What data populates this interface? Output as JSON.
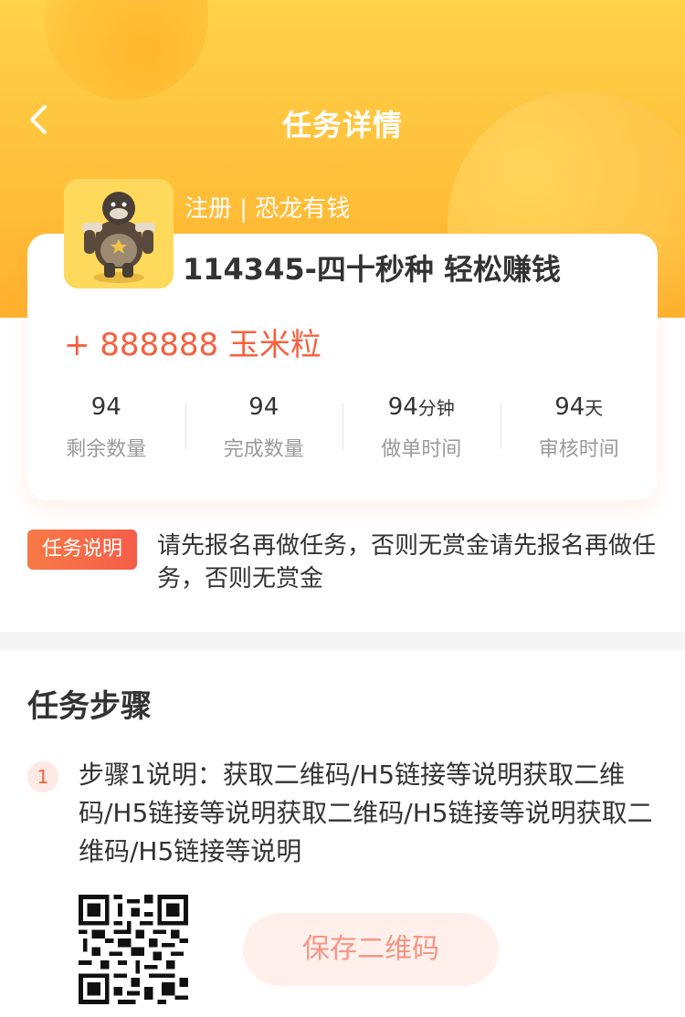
{
  "nav": {
    "title": "任务详情",
    "back_icon": "chevron-left-icon"
  },
  "task": {
    "tag": "注册 | 恐龙有钱",
    "title": "114345-四十秒种 轻松赚钱",
    "reward": "+ 888888 玉米粒"
  },
  "stats": [
    {
      "value": "94",
      "unit": "",
      "label": "剩余数量"
    },
    {
      "value": "94",
      "unit": "",
      "label": "完成数量"
    },
    {
      "value": "94",
      "unit": "分钟",
      "label": "做单时间"
    },
    {
      "value": "94",
      "unit": "天",
      "label": "审核时间"
    }
  ],
  "description": {
    "badge": "任务说明",
    "text": "请先报名再做任务，否则无赏金请先报名再做任务，否则无赏金"
  },
  "steps": {
    "title": "任务步骤",
    "items": [
      {
        "num": "1",
        "text": "步骤1说明：获取二维码/H5链接等说明获取二维码/H5链接等说明获取二维码/H5链接等说明获取二维码/H5链接等说明"
      }
    ],
    "save_qr_label": "保存二维码"
  },
  "colors": {
    "header": "#ffc03a",
    "accent": "#f7603d",
    "badge": "#f76a47"
  }
}
